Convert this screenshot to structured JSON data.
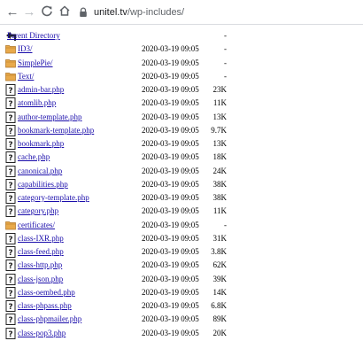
{
  "browser": {
    "url_domain": "unitel.tv",
    "url_path": "/wp-includes/",
    "icons": [
      "back-icon",
      "forward-icon",
      "reload-icon",
      "lock-icon"
    ]
  },
  "parent": {
    "label": "Parent Directory",
    "size": "-"
  },
  "entries": [
    {
      "name": "ID3/",
      "date": "2020-03-19 09:05",
      "size": "-",
      "type": "folder"
    },
    {
      "name": "SimplePie/",
      "date": "2020-03-19 09:05",
      "size": "-",
      "type": "folder"
    },
    {
      "name": "Text/",
      "date": "2020-03-19 09:05",
      "size": "-",
      "type": "folder"
    },
    {
      "name": "admin-bar.php",
      "date": "2020-03-19 09:05",
      "size": "23K",
      "type": "file"
    },
    {
      "name": "atomlib.php",
      "date": "2020-03-19 09:05",
      "size": "11K",
      "type": "file"
    },
    {
      "name": "author-template.php",
      "date": "2020-03-19 09:05",
      "size": "13K",
      "type": "file"
    },
    {
      "name": "bookmark-template.php",
      "date": "2020-03-19 09:05",
      "size": "9.7K",
      "type": "file"
    },
    {
      "name": "bookmark.php",
      "date": "2020-03-19 09:05",
      "size": "13K",
      "type": "file"
    },
    {
      "name": "cache.php",
      "date": "2020-03-19 09:05",
      "size": "18K",
      "type": "file"
    },
    {
      "name": "canonical.php",
      "date": "2020-03-19 09:05",
      "size": "24K",
      "type": "file"
    },
    {
      "name": "capabilities.php",
      "date": "2020-03-19 09:05",
      "size": "38K",
      "type": "file"
    },
    {
      "name": "category-template.php",
      "date": "2020-03-19 09:05",
      "size": "38K",
      "type": "file"
    },
    {
      "name": "category.php",
      "date": "2020-03-19 09:05",
      "size": "11K",
      "type": "file"
    },
    {
      "name": "certificates/",
      "date": "2020-03-19 09:05",
      "size": "-",
      "type": "folder"
    },
    {
      "name": "class-IXR.php",
      "date": "2020-03-19 09:05",
      "size": "31K",
      "type": "file"
    },
    {
      "name": "class-feed.php",
      "date": "2020-03-19 09:05",
      "size": "3.8K",
      "type": "file"
    },
    {
      "name": "class-http.php",
      "date": "2020-03-19 09:05",
      "size": "62K",
      "type": "file"
    },
    {
      "name": "class-json.php",
      "date": "2020-03-19 09:05",
      "size": "39K",
      "type": "file"
    },
    {
      "name": "class-oembed.php",
      "date": "2020-03-19 09:05",
      "size": "14K",
      "type": "file"
    },
    {
      "name": "class-phpass.php",
      "date": "2020-03-19 09:05",
      "size": "6.8K",
      "type": "file"
    },
    {
      "name": "class-phpmailer.php",
      "date": "2020-03-19 09:05",
      "size": "89K",
      "type": "file"
    },
    {
      "name": "class-pop3.php",
      "date": "2020-03-19 09:05",
      "size": "20K",
      "type": "file"
    }
  ]
}
